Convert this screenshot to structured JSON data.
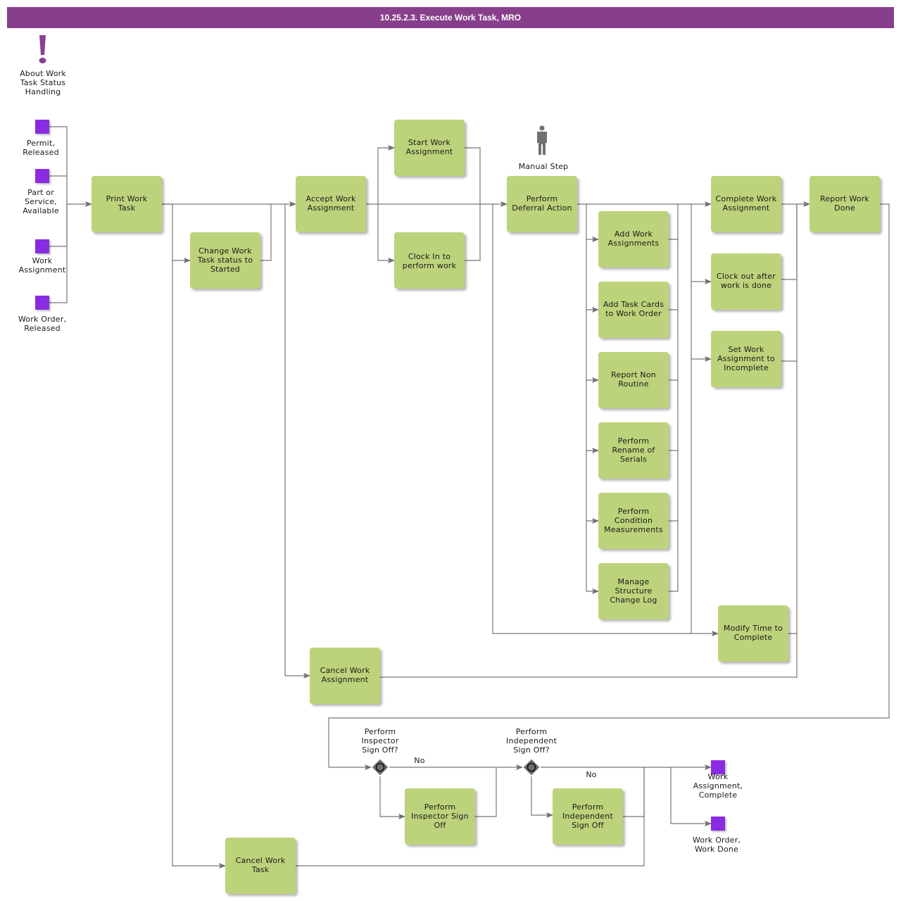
{
  "header": {
    "title": "10.25.2.3. Execute Work Task, MRO"
  },
  "annotations": {
    "about_note": "About Work\nTask Status\nHandling",
    "manual_step": "Manual Step"
  },
  "start_events": [
    {
      "id": "permit-released",
      "label": "Permit,\nReleased"
    },
    {
      "id": "part-service-available",
      "label": "Part or\nService,\nAvailable"
    },
    {
      "id": "work-assignment",
      "label": "Work\nAssignment"
    },
    {
      "id": "work-order-released",
      "label": "Work Order,\nReleased"
    }
  ],
  "end_events": [
    {
      "id": "work-assignment-complete",
      "label": "Work\nAssignment,\nComplete"
    },
    {
      "id": "work-order-work-done",
      "label": "Work Order,\nWork Done"
    }
  ],
  "tasks": [
    {
      "id": "print-work-task",
      "label": "Print Work\nTask"
    },
    {
      "id": "change-work-task-status",
      "label": "Change Work\nTask status to\nStarted"
    },
    {
      "id": "accept-work-assignment",
      "label": "Accept Work\nAssignment"
    },
    {
      "id": "start-work-assignment",
      "label": "Start Work\nAssignment"
    },
    {
      "id": "clock-in",
      "label": "Clock In to\nperform work"
    },
    {
      "id": "perform-deferral-action",
      "label": "Perform\nDeferral Action"
    },
    {
      "id": "add-work-assignments",
      "label": "Add Work\nAssignments"
    },
    {
      "id": "add-task-cards",
      "label": "Add Task Cards\nto Work Order"
    },
    {
      "id": "report-non-routine",
      "label": "Report Non\nRoutine"
    },
    {
      "id": "perform-rename-serials",
      "label": "Perform\nRename of\nSerials"
    },
    {
      "id": "perform-condition-measurements",
      "label": "Perform\nCondition\nMeasurements"
    },
    {
      "id": "manage-structure-change-log",
      "label": "Manage\nStructure\nChange Log"
    },
    {
      "id": "complete-work-assignment",
      "label": "Complete Work\nAssignment"
    },
    {
      "id": "clock-out",
      "label": "Clock out after\nwork is done"
    },
    {
      "id": "set-incomplete",
      "label": "Set Work\nAssignment to\nIncomplete"
    },
    {
      "id": "modify-time-to-complete",
      "label": "Modify Time to\nComplete"
    },
    {
      "id": "report-work-done",
      "label": "Report Work\nDone"
    },
    {
      "id": "cancel-work-assignment",
      "label": "Cancel Work\nAssignment"
    },
    {
      "id": "perform-inspector-sign-off",
      "label": "Perform\nInspector Sign\nOff"
    },
    {
      "id": "perform-independent-sign-off",
      "label": "Perform\nIndependent\nSign Off"
    },
    {
      "id": "cancel-work-task",
      "label": "Cancel Work\nTask"
    }
  ],
  "gateways": [
    {
      "id": "inspector-gateway",
      "question": "Perform\nInspector\nSign Off?",
      "no_label": "No"
    },
    {
      "id": "independent-gateway",
      "question": "Perform\nIndependent\nSign Off?",
      "no_label": "No"
    }
  ],
  "colors": {
    "header": "#873f8b",
    "task": "#bdd37b",
    "event": "#8a2be2",
    "connector": "#707070",
    "note_icon": "#8b3f8f",
    "person_icon": "#707070",
    "gateway": "#6e6e6e"
  }
}
